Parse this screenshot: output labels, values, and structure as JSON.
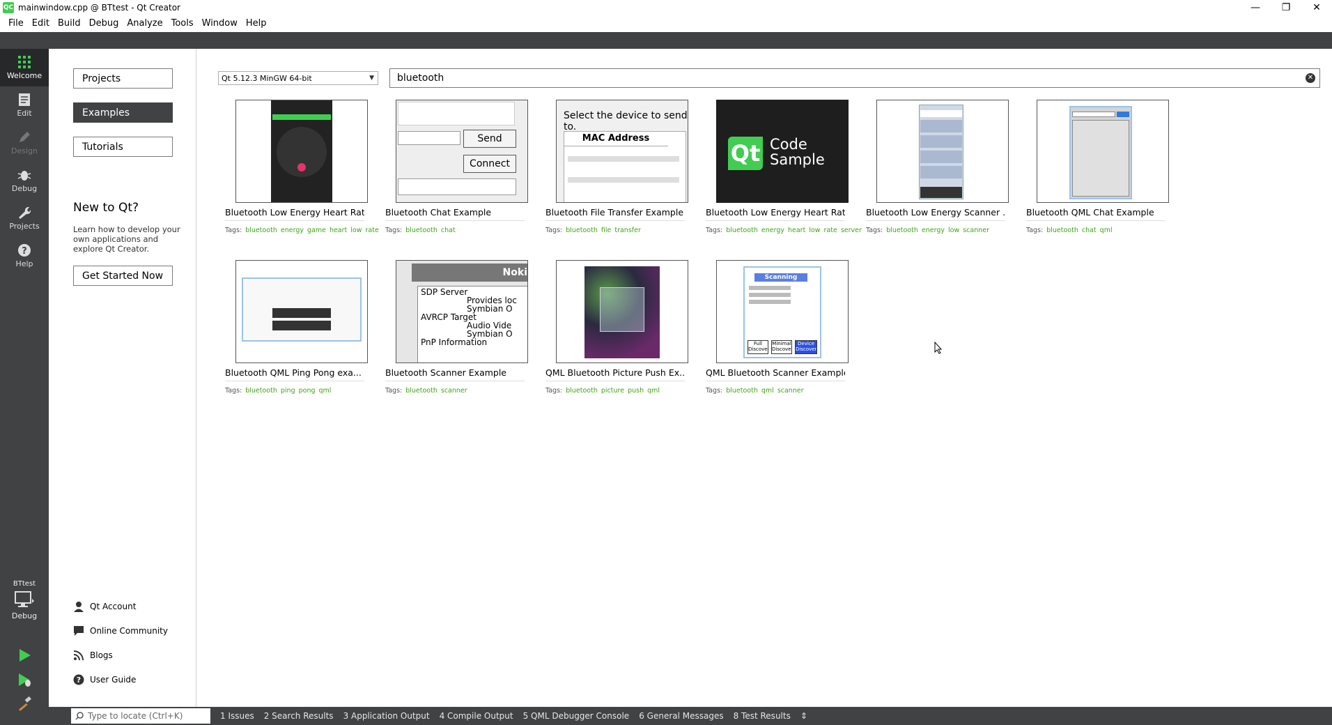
{
  "window": {
    "title": "mainwindow.cpp @ BTtest - Qt Creator",
    "app_icon": "QC"
  },
  "menu": [
    "File",
    "Edit",
    "Build",
    "Debug",
    "Analyze",
    "Tools",
    "Window",
    "Help"
  ],
  "modes": [
    {
      "label": "Welcome",
      "icon": "grid-icon"
    },
    {
      "label": "Edit",
      "icon": "document-icon"
    },
    {
      "label": "Design",
      "icon": "pencil-icon"
    },
    {
      "label": "Debug",
      "icon": "bug-icon"
    },
    {
      "label": "Projects",
      "icon": "wrench-icon"
    },
    {
      "label": "Help",
      "icon": "question-icon"
    }
  ],
  "target": {
    "project": "BTtest",
    "config": "Debug"
  },
  "welcome": {
    "nav": [
      "Projects",
      "Examples",
      "Tutorials"
    ],
    "new_title": "New to Qt?",
    "new_desc": "Learn how to develop your own applications and explore Qt Creator.",
    "get_started": "Get Started Now",
    "links": [
      "Qt Account",
      "Online Community",
      "Blogs",
      "User Guide"
    ]
  },
  "kit": "Qt 5.12.3 MinGW 64-bit",
  "search": "bluetooth",
  "tags_label": "Tags:",
  "examples": [
    {
      "title": "Bluetooth Low Energy Heart Rat...",
      "tags": [
        "bluetooth",
        "energy",
        "game",
        "heart",
        "low",
        "rate"
      ]
    },
    {
      "title": "Bluetooth Chat Example",
      "tags": [
        "bluetooth",
        "chat"
      ]
    },
    {
      "title": "Bluetooth File Transfer Example",
      "tags": [
        "bluetooth",
        "file",
        "transfer"
      ]
    },
    {
      "title": "Bluetooth Low Energy Heart Rat...",
      "tags": [
        "bluetooth",
        "energy",
        "heart",
        "low",
        "rate",
        "server"
      ]
    },
    {
      "title": "Bluetooth Low Energy Scanner ...",
      "tags": [
        "bluetooth",
        "energy",
        "low",
        "scanner"
      ]
    },
    {
      "title": "Bluetooth QML Chat Example",
      "tags": [
        "bluetooth",
        "chat",
        "qml"
      ]
    },
    {
      "title": "Bluetooth QML Ping Pong exa...",
      "tags": [
        "bluetooth",
        "ping",
        "pong",
        "qml"
      ]
    },
    {
      "title": "Bluetooth Scanner Example",
      "tags": [
        "bluetooth",
        "scanner"
      ]
    },
    {
      "title": "QML Bluetooth Picture Push Ex...",
      "tags": [
        "bluetooth",
        "picture",
        "push",
        "qml"
      ]
    },
    {
      "title": "QML Bluetooth Scanner Example",
      "tags": [
        "bluetooth",
        "qml",
        "scanner"
      ]
    }
  ],
  "thumbs": {
    "chat": {
      "send": "Send",
      "connect": "Connect"
    },
    "file": {
      "heading": "Select the device to send to.",
      "column": "MAC Address"
    },
    "code": {
      "logo": "Qt",
      "line1": "Code",
      "line2": "Sample"
    },
    "scanner": {
      "title": "Noki",
      "rows": [
        "SDP Server",
        "Provides loc",
        "Symbian O",
        "AVRCP Target",
        "Audio Vide",
        "Symbian O",
        "PnP Information"
      ]
    },
    "qmlscan": {
      "title": "Scanning",
      "buttons": [
        "Full Discovery",
        "Minimal Discovery",
        "Device Discovery"
      ]
    }
  },
  "locator_placeholder": "Type to locate (Ctrl+K)",
  "output_tabs": [
    "1  Issues",
    "2  Search Results",
    "3  Application Output",
    "4  Compile Output",
    "5  QML Debugger Console",
    "6  General Messages",
    "8  Test Results"
  ]
}
